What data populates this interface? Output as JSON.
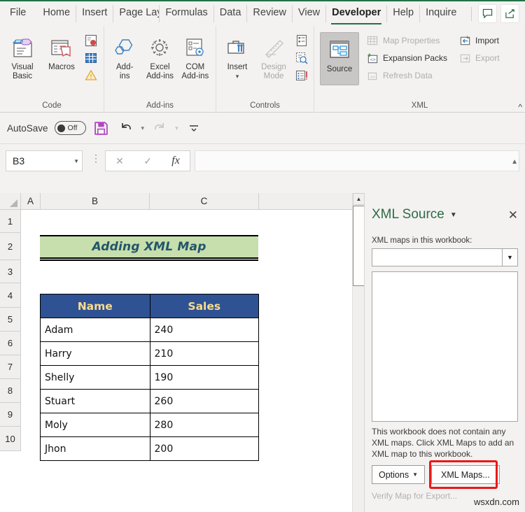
{
  "tabs": [
    {
      "label": "File",
      "active": false
    },
    {
      "label": "Home",
      "active": false
    },
    {
      "label": "Insert",
      "active": false
    },
    {
      "label": "Page Layou",
      "active": false
    },
    {
      "label": "Formulas",
      "active": false
    },
    {
      "label": "Data",
      "active": false
    },
    {
      "label": "Review",
      "active": false
    },
    {
      "label": "View",
      "active": false
    },
    {
      "label": "Developer",
      "active": true
    },
    {
      "label": "Help",
      "active": false
    },
    {
      "label": "Inquire",
      "active": false
    }
  ],
  "tabbar_icons": [
    {
      "name": "comment-icon"
    },
    {
      "name": "share-icon"
    }
  ],
  "ribbon": {
    "groups": [
      {
        "label": "Code",
        "big": [
          {
            "label_line1": "Visual",
            "label_line2": "Basic",
            "icon": "visual-basic-icon",
            "disabled": false
          },
          {
            "label_line1": "Macros",
            "label_line2": "",
            "icon": "macros-icon",
            "disabled": false
          }
        ],
        "small": [
          {
            "label": "",
            "icon": "record-macro-icon",
            "disabled": false
          },
          {
            "label": "",
            "icon": "use-relative-references-icon",
            "disabled": false
          },
          {
            "label": "",
            "icon": "macro-security-icon",
            "disabled": false
          }
        ]
      },
      {
        "label": "Add-ins",
        "big": [
          {
            "label_line1": "Add-",
            "label_line2": "ins",
            "icon": "add-ins-icon",
            "disabled": false
          },
          {
            "label_line1": "Excel",
            "label_line2": "Add-ins",
            "icon": "excel-add-ins-icon",
            "disabled": false
          },
          {
            "label_line1": "COM",
            "label_line2": "Add-ins",
            "icon": "com-add-ins-icon",
            "disabled": false
          }
        ],
        "small": []
      },
      {
        "label": "Controls",
        "big": [
          {
            "label_line1": "Insert",
            "label_line2": "",
            "icon": "insert-controls-icon",
            "disabled": false
          },
          {
            "label_line1": "Design",
            "label_line2": "Mode",
            "icon": "design-mode-icon",
            "disabled": true
          }
        ],
        "small": [
          {
            "label": "",
            "icon": "properties-icon",
            "disabled": false
          },
          {
            "label": "",
            "icon": "view-code-icon",
            "disabled": false
          },
          {
            "label": "",
            "icon": "run-dialog-icon",
            "disabled": false
          }
        ]
      },
      {
        "label": "XML",
        "big": [
          {
            "label_line1": "Source",
            "label_line2": "",
            "icon": "xml-source-icon",
            "disabled": false,
            "pressed": true
          }
        ],
        "small": [
          {
            "label": "Map Properties",
            "icon": "map-properties-icon",
            "disabled": true
          },
          {
            "label": "Expansion Packs",
            "icon": "expansion-packs-icon",
            "disabled": false
          },
          {
            "label": "Refresh Data",
            "icon": "refresh-data-icon",
            "disabled": true
          },
          {
            "label": "Import",
            "icon": "import-icon",
            "disabled": false
          },
          {
            "label": "Export",
            "icon": "export-icon",
            "disabled": true
          }
        ]
      }
    ],
    "collapse_icon": "collapse-ribbon-icon"
  },
  "qat": {
    "autosave_label": "AutoSave",
    "autosave_state": "Off",
    "save_icon": "save-icon",
    "undo_icon": "undo-icon",
    "redo_icon": "redo-icon",
    "more_icon": "customize-qat-icon"
  },
  "formula_bar": {
    "name_box_value": "B3",
    "cancel_icon": "cancel-icon",
    "enter_icon": "enter-icon",
    "function_icon": "insert-function-icon",
    "formula_value": "",
    "expand_icon": "expand-formula-bar-icon"
  },
  "grid": {
    "columns": [
      "A",
      "B",
      "C"
    ],
    "rows": [
      "1",
      "2",
      "3",
      "4",
      "5",
      "6",
      "7",
      "8",
      "9",
      "10"
    ],
    "title_cell": {
      "text": "Adding XML Map",
      "fill": "#c7dfad",
      "font_color": "#23556b"
    },
    "table": {
      "headers": [
        "Name",
        "Sales"
      ],
      "header_fill": "#2e5293",
      "header_font_color": "#fbdc8d",
      "rows": [
        [
          "Adam",
          "240"
        ],
        [
          "Harry",
          "210"
        ],
        [
          "Shelly",
          "190"
        ],
        [
          "Stuart",
          "260"
        ],
        [
          "Moly",
          "280"
        ],
        [
          "Jhon",
          "200"
        ]
      ]
    }
  },
  "task_pane": {
    "title": "XML Source",
    "menu_icon": "pane-menu-caret-icon",
    "close_icon": "close-icon",
    "maps_label": "XML maps in this workbook:",
    "combo_value": "",
    "message": "This workbook does not contain any XML maps. Click XML Maps to add an XML map to this workbook.",
    "options_button": "Options",
    "xml_maps_button": "XML Maps...",
    "verify_link": "Verify Map for Export...",
    "highlight_color": "#e8191b"
  },
  "watermark": "wsxdn.com"
}
